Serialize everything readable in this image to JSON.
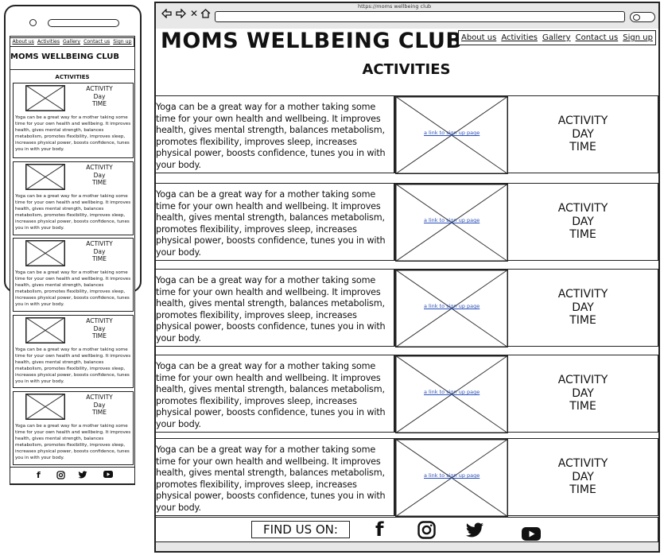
{
  "browser": {
    "url": "https://moms wellbeing club"
  },
  "site_title": "MOMS WELLBEING CLUB",
  "nav": [
    "About us",
    "Activities",
    "Gallery",
    "Contact us",
    "Sign up"
  ],
  "activities_heading": "ACTIVITIES",
  "activity_description": "Yoga can be a great way for a mother taking some time for your own health and wellbeing. It improves health, gives mental strength, balances metabolism, promotes flexibility, improves sleep, increases physical power, boosts confidence, tunes you in with your body.",
  "image_link_text": "a link to sign up page",
  "activity_info": {
    "activity": "ACTIVITY",
    "day": "DAY",
    "time": "TIME"
  },
  "mobile_info": {
    "activity": "ACTIVITY",
    "day": "Day",
    "time": "TIME"
  },
  "footer": {
    "find_us": "FIND US ON:"
  },
  "social_icons": [
    "facebook-icon",
    "instagram-icon",
    "twitter-icon",
    "youtube-icon"
  ]
}
